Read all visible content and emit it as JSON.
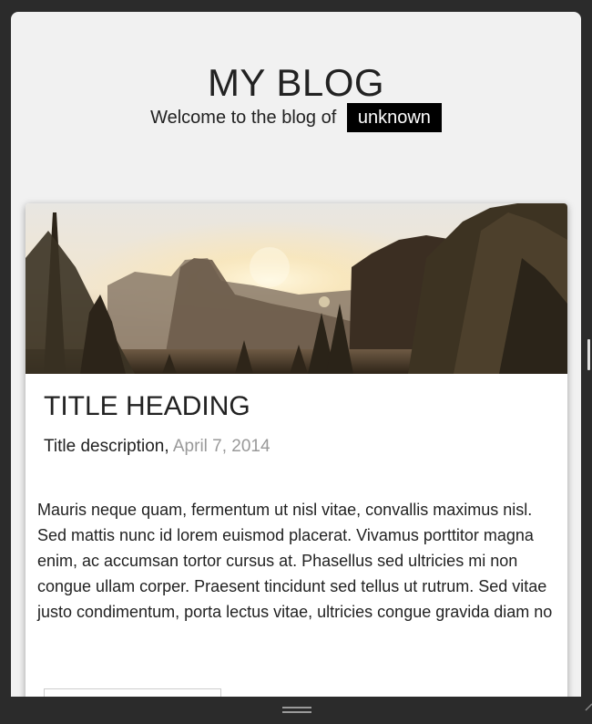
{
  "blog": {
    "title": "MY BLOG",
    "welcome_text": "Welcome to the blog of",
    "author": "unknown"
  },
  "post": {
    "title": "TITLE HEADING",
    "description": "Title description,",
    "date": "April 7, 2014",
    "body": "Mauris neque quam, fermentum ut nisl vitae, convallis maximus nisl. Sed mattis nunc id lorem euismod placerat. Vivamus porttitor magna enim, ac accumsan tortor cursus at. Phasellus sed ultricies mi non congue ullam corper. Praesent tincidunt sed tellus ut rutrum. Sed vitae justo condimentum, porta lectus vitae, ultricies congue gravida diam no"
  },
  "icons": {
    "hero_image": "mountain-sunset-forest-image",
    "resize_grip": "drag-grip-icon",
    "scrollbar": "scrollbar-thumb"
  },
  "colors": {
    "page_background": "#f1f1f1",
    "frame": "#2b2b2b",
    "tag_background": "#000000",
    "date_text": "#999999"
  }
}
